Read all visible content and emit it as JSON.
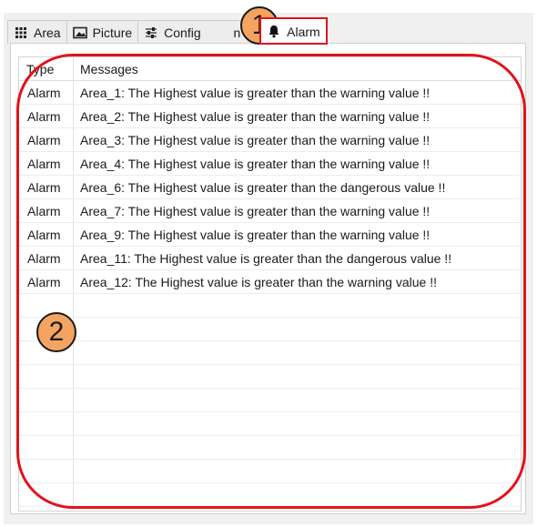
{
  "tabs": [
    {
      "label": "Area",
      "icon": "grid-dots-icon"
    },
    {
      "label": "Picture",
      "icon": "image-icon"
    },
    {
      "label": "Configuration",
      "icon": "sliders-icon",
      "visible_text": "Config n"
    },
    {
      "label": "Alarm",
      "icon": "bell-icon",
      "active": true
    }
  ],
  "table": {
    "columns": [
      "Type",
      "Messages"
    ],
    "rows": [
      {
        "type": "Alarm",
        "message": "Area_1: The Highest value is greater than the warning value !!"
      },
      {
        "type": "Alarm",
        "message": "Area_2: The Highest value is greater than the warning value !!"
      },
      {
        "type": "Alarm",
        "message": "Area_3: The Highest value is greater than the warning value !!"
      },
      {
        "type": "Alarm",
        "message": "Area_4: The Highest value is greater than the warning value !!"
      },
      {
        "type": "Alarm",
        "message": "Area_6: The Highest value is greater than the dangerous value !!"
      },
      {
        "type": "Alarm",
        "message": "Area_7: The Highest value is greater than the warning value !!"
      },
      {
        "type": "Alarm",
        "message": "Area_9: The Highest value is greater than the warning value !!"
      },
      {
        "type": "Alarm",
        "message": "Area_11: The Highest value is greater than the dangerous value !!"
      },
      {
        "type": "Alarm",
        "message": "Area_12: The Highest value is greater than the warning value !!"
      }
    ]
  },
  "annotations": {
    "callout_1": "1",
    "callout_2": "2"
  },
  "colors": {
    "highlight": "#e0141b",
    "callout_fill": "#f4a460"
  }
}
